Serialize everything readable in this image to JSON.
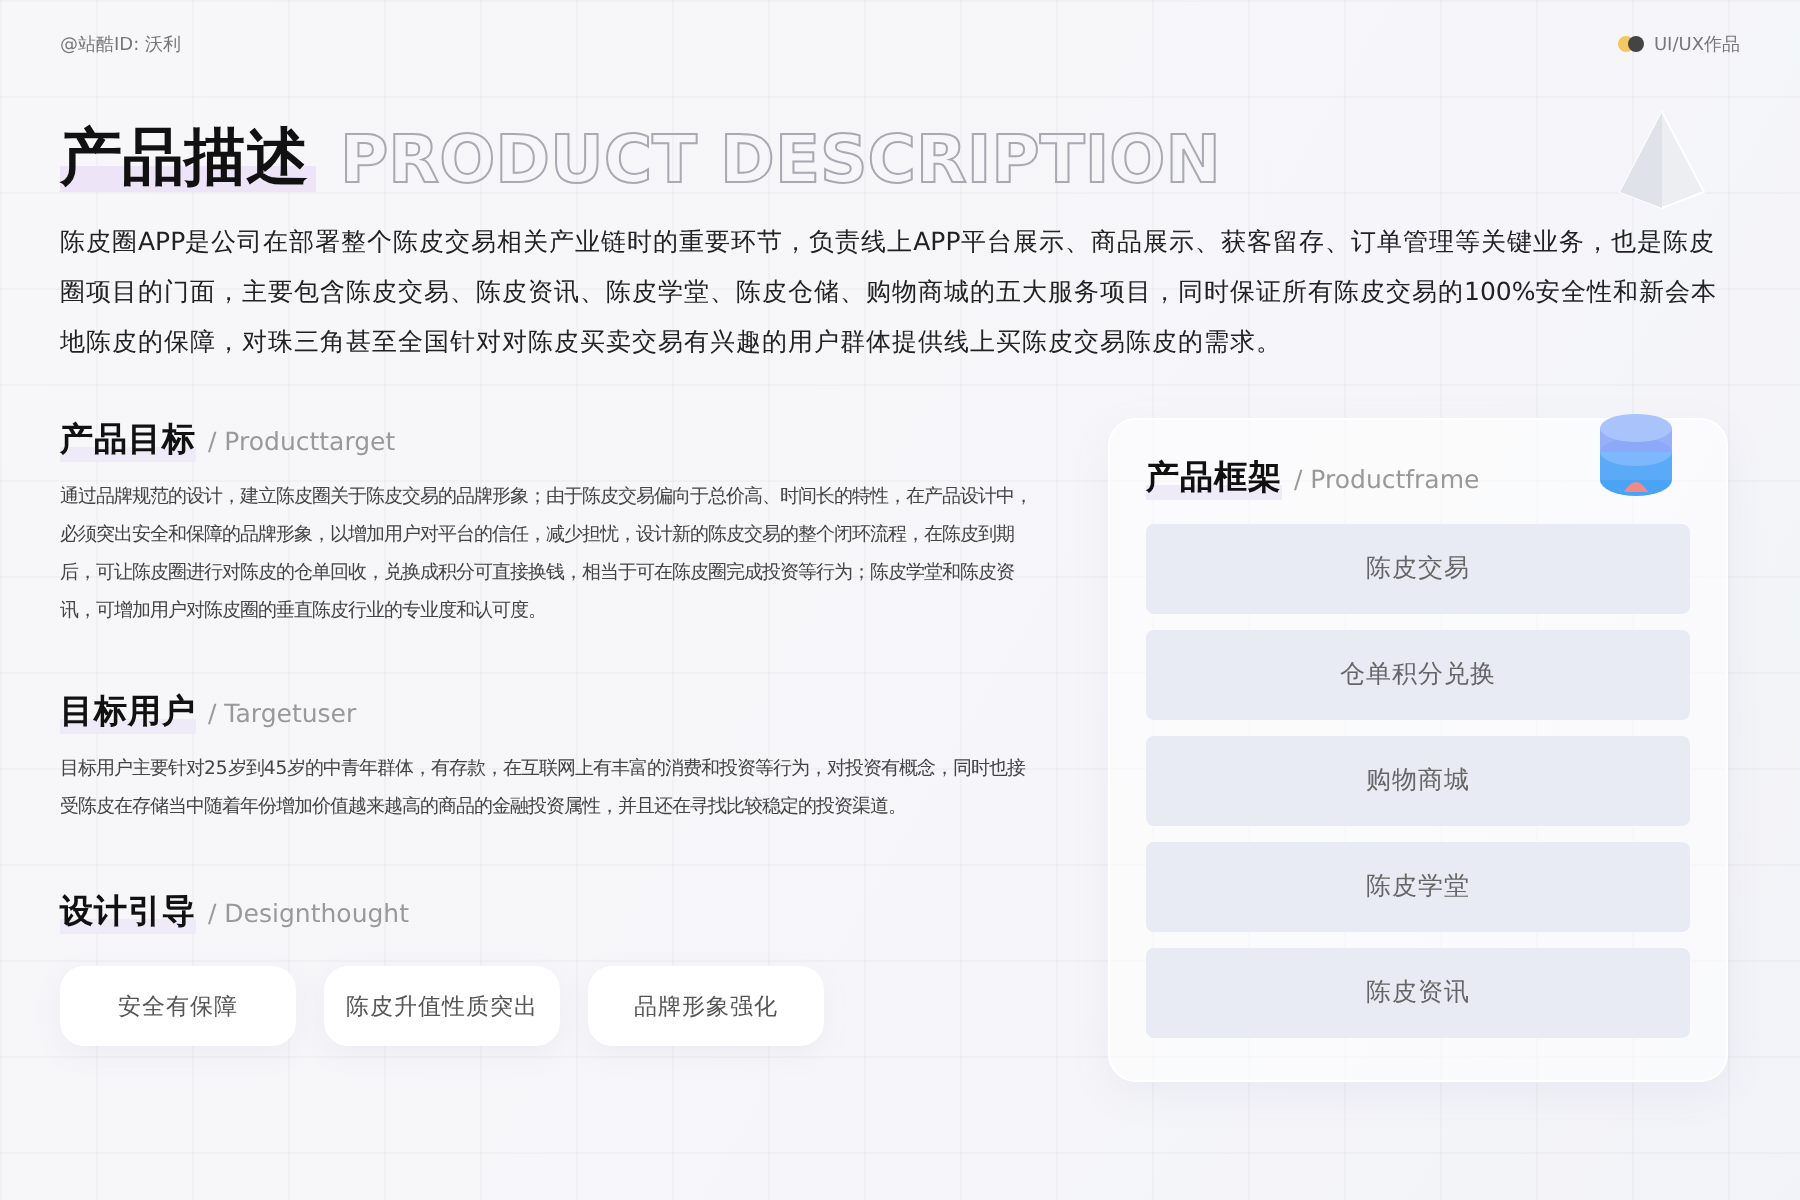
{
  "header": {
    "author": "@站酷ID: 沃利",
    "tag": "UI/UX作品"
  },
  "title": {
    "text": "产品描述",
    "outline": "PRODUCT DESCRIPTION"
  },
  "intro": "陈皮圈APP是公司在部署整个陈皮交易相关产业链时的重要环节，负责线上APP平台展示、商品展示、获客留存、订单管理等关键业务，也是陈皮圈项目的门面，主要包含陈皮交易、陈皮资讯、陈皮学堂、陈皮仓储、购物商城的五大服务项目，同时保证所有陈皮交易的100%安全性和新会本地陈皮的保障，对珠三角甚至全国针对对陈皮买卖交易有兴趣的用户群体提供线上买陈皮交易陈皮的需求。",
  "sections": [
    {
      "kind": "text",
      "title": "产品目标",
      "subtitle": "/ Producttarget",
      "body": "通过品牌规范的设计，建立陈皮圈关于陈皮交易的品牌形象；由于陈皮交易偏向于总价高、时间长的特性，在产品设计中，必须突出安全和保障的品牌形象，以增加用户对平台的信任，减少担忧，设计新的陈皮交易的整个闭环流程，在陈皮到期后，可让陈皮圈进行对陈皮的仓单回收，兑换成积分可直接换钱，相当于可在陈皮圈完成投资等行为；陈皮学堂和陈皮资讯，可增加用户对陈皮圈的垂直陈皮行业的专业度和认可度。"
    },
    {
      "kind": "text",
      "title": "目标用户",
      "subtitle": "/ Targetuser",
      "body": "目标用户主要针对25岁到45岁的中青年群体，有存款，在互联网上有丰富的消费和投资等行为，对投资有概念，同时也接受陈皮在存储当中随着年份增加价值越来越高的商品的金融投资属性，并且还在寻找比较稳定的投资渠道。"
    },
    {
      "kind": "chips",
      "title": "设计引导",
      "subtitle": "/ Designthought",
      "chips": [
        "安全有保障",
        "陈皮升值性质突出",
        "品牌形象强化"
      ]
    }
  ],
  "framework": {
    "title": "产品框架",
    "subtitle": "/ Productframe",
    "items": [
      "陈皮交易",
      "仓单积分兑换",
      "购物商城",
      "陈皮学堂",
      "陈皮资讯"
    ]
  }
}
